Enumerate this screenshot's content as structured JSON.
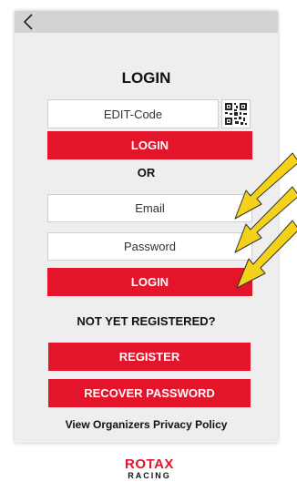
{
  "header": {
    "back_icon": "chevron-left-icon"
  },
  "login": {
    "title": "LOGIN",
    "edit_code_placeholder": "EDIT-Code",
    "qr_icon": "qr-code-icon",
    "edit_login_label": "LOGIN",
    "or_label": "OR",
    "email_placeholder": "Email",
    "password_placeholder": "Password",
    "email_login_label": "LOGIN"
  },
  "register": {
    "heading": "NOT YET REGISTERED?",
    "register_label": "REGISTER",
    "recover_label": "RECOVER PASSWORD"
  },
  "footer": {
    "privacy_link": "View Organizers Privacy Policy",
    "logo_line1": "ROTAX",
    "logo_line2": "RACING"
  },
  "colors": {
    "accent_red": "#e4142a",
    "annotation_arrow": "#f5d21a"
  }
}
